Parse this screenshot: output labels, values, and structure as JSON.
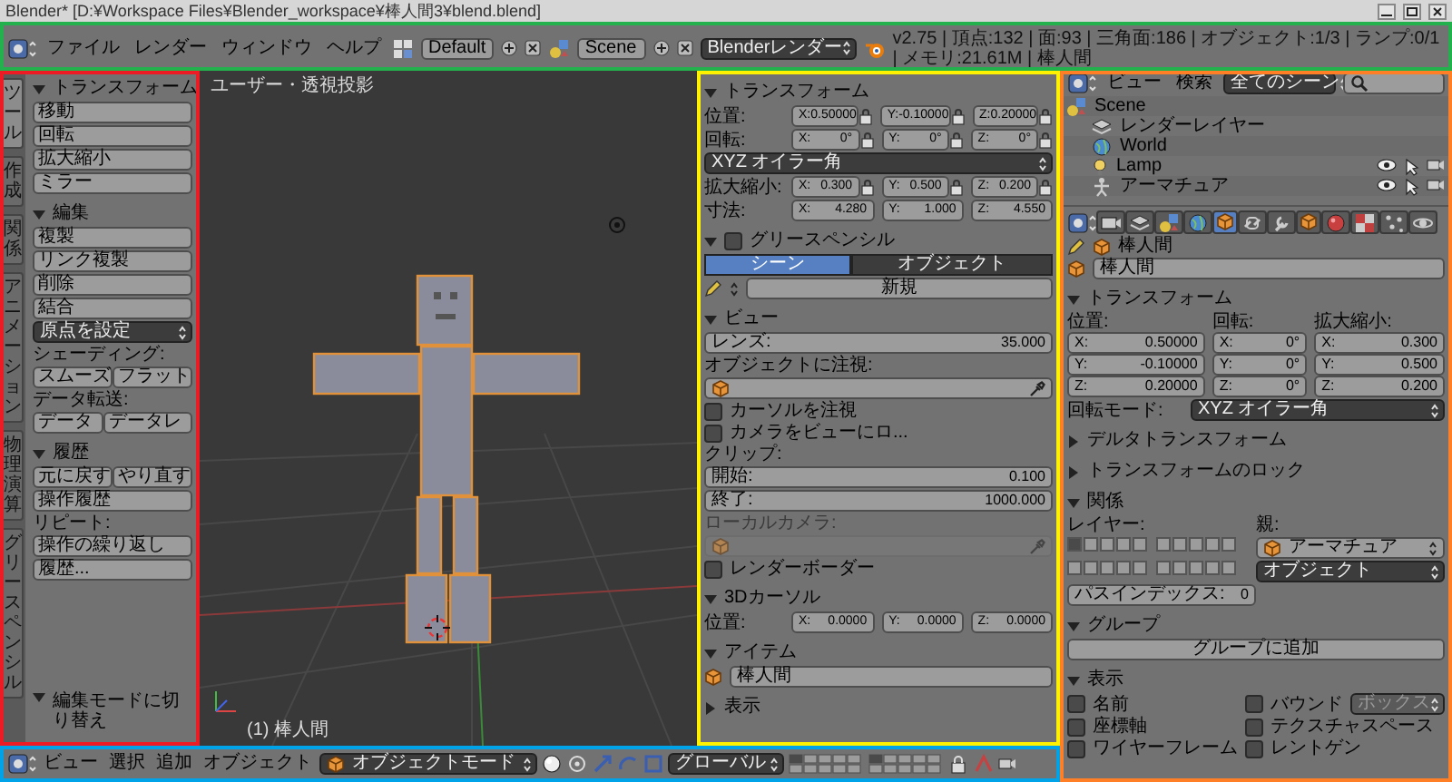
{
  "window": {
    "title": "Blender* [D:¥Workspace Files¥Blender_workspace¥棒人間3¥blend.blend]"
  },
  "highlights": [
    {
      "color": "#22b14c"
    },
    {
      "color": "#ed1c24"
    },
    {
      "color": "#fff200"
    },
    {
      "color": "#ff7f27"
    },
    {
      "color": "#00a2e8"
    }
  ],
  "header": {
    "menus": [
      "ファイル",
      "レンダー",
      "ウィンドウ",
      "ヘルプ"
    ],
    "layout": "Default",
    "scene": "Scene",
    "engine": "Blenderレンダー",
    "stats": "v2.75 | 頂点:132 | 面:93 | 三角面:186 | オブジェクト:1/3 | ランプ:0/1 | メモリ:21.61M | 棒人間"
  },
  "tool_shelf": {
    "tabs": [
      {
        "label": "ツール",
        "selected": true
      },
      {
        "label": "作成",
        "selected": false
      },
      {
        "label": "関係",
        "selected": false
      },
      {
        "label": "アニメーション",
        "selected": false
      },
      {
        "label": "物理演算",
        "selected": false
      },
      {
        "label": "グリースペンシル",
        "selected": false
      }
    ],
    "panels": [
      {
        "title": "トランスフォーム",
        "expanded": true,
        "items": [
          {
            "kind": "buttons",
            "labels": [
              "移動"
            ]
          },
          {
            "kind": "buttons",
            "labels": [
              "回転"
            ]
          },
          {
            "kind": "buttons",
            "labels": [
              "拡大縮小"
            ]
          },
          {
            "kind": "buttons",
            "labels": [
              "ミラー"
            ]
          }
        ]
      },
      {
        "title": "編集",
        "expanded": true,
        "items": [
          {
            "kind": "buttons",
            "labels": [
              "複製"
            ]
          },
          {
            "kind": "buttons",
            "labels": [
              "リンク複製"
            ]
          },
          {
            "kind": "buttons",
            "labels": [
              "削除"
            ]
          },
          {
            "kind": "buttons",
            "labels": [
              "結合"
            ]
          },
          {
            "kind": "dropdown",
            "text": "原点を設定"
          },
          {
            "kind": "label",
            "text": "シェーディング:"
          },
          {
            "kind": "buttons",
            "labels": [
              "スムーズ",
              "フラット"
            ]
          },
          {
            "kind": "label",
            "text": "データ転送:"
          },
          {
            "kind": "buttons",
            "labels": [
              "データ",
              "データレ"
            ]
          }
        ]
      },
      {
        "title": "履歴",
        "expanded": true,
        "items": [
          {
            "kind": "buttons",
            "labels": [
              "元に戻す",
              "やり直す"
            ]
          },
          {
            "kind": "buttons",
            "labels": [
              "操作履歴"
            ]
          },
          {
            "kind": "label",
            "text": "リピート:"
          },
          {
            "kind": "buttons",
            "labels": [
              "操作の繰り返し"
            ]
          },
          {
            "kind": "buttons",
            "labels": [
              "履歴..."
            ]
          }
        ]
      }
    ],
    "operator_panel": {
      "title": "編集モードに切り替え",
      "expanded": true
    }
  },
  "viewport": {
    "view_label": "ユーザー・透視投影",
    "object_label": "(1) 棒人間"
  },
  "n_panel": {
    "panels": [
      {
        "title": "トランスフォーム",
        "expanded": true,
        "items": [
          {
            "kind": "vector",
            "label": "位置:",
            "lockable": true,
            "fields": [
              {
                "axis": "X:",
                "value": "0.50000"
              },
              {
                "axis": "Y:",
                "value": "-0.10000"
              },
              {
                "axis": "Z:",
                "value": "0.20000"
              }
            ]
          },
          {
            "kind": "vector",
            "label": "回転:",
            "lockable": true,
            "fields": [
              {
                "axis": "X:",
                "value": "0°"
              },
              {
                "axis": "Y:",
                "value": "0°"
              },
              {
                "axis": "Z:",
                "value": "0°"
              }
            ]
          },
          {
            "kind": "dropdown",
            "text": "XYZ オイラー角"
          },
          {
            "kind": "vector",
            "label": "拡大縮小:",
            "lockable": true,
            "fields": [
              {
                "axis": "X:",
                "value": "0.300"
              },
              {
                "axis": "Y:",
                "value": "0.500"
              },
              {
                "axis": "Z:",
                "value": "0.200"
              }
            ]
          },
          {
            "kind": "vector",
            "label": "寸法:",
            "lockable": false,
            "fields": [
              {
                "axis": "X:",
                "value": "4.280"
              },
              {
                "axis": "Y:",
                "value": "1.000"
              },
              {
                "axis": "Z:",
                "value": "4.550"
              }
            ]
          }
        ]
      },
      {
        "title": "グリースペンシル",
        "expanded": true,
        "checkbox": false,
        "items": [
          {
            "kind": "toggle",
            "options": [
              {
                "label": "シーン",
                "selected": true
              },
              {
                "label": "オブジェクト",
                "selected": false
              }
            ]
          },
          {
            "kind": "new",
            "text": "新規"
          }
        ]
      },
      {
        "title": "ビュー",
        "expanded": true,
        "items": [
          {
            "kind": "number",
            "label": "レンズ:",
            "value": "35.000"
          },
          {
            "kind": "label",
            "text": "オブジェクトに注視:",
            "disabled": false
          },
          {
            "kind": "object",
            "disabled": false
          },
          {
            "kind": "check",
            "text": "カーソルを注視",
            "checked": false
          },
          {
            "kind": "check",
            "text": "カメラをビューにロ...",
            "checked": false
          },
          {
            "kind": "label",
            "text": "クリップ:",
            "disabled": false
          },
          {
            "kind": "number",
            "label": "開始:",
            "value": "0.100"
          },
          {
            "kind": "number",
            "label": "終了:",
            "value": "1000.000"
          },
          {
            "kind": "label",
            "text": "ローカルカメラ:",
            "disabled": true
          },
          {
            "kind": "object",
            "disabled": true
          },
          {
            "kind": "check",
            "text": "レンダーボーダー",
            "checked": false
          }
        ]
      },
      {
        "title": "3Dカーソル",
        "expanded": true,
        "items": [
          {
            "kind": "vector",
            "label": "位置:",
            "lockable": false,
            "fields": [
              {
                "axis": "X:",
                "value": "0.0000"
              },
              {
                "axis": "Y:",
                "value": "0.0000"
              },
              {
                "axis": "Z:",
                "value": "0.0000"
              }
            ]
          }
        ]
      },
      {
        "title": "アイテム",
        "expanded": true,
        "items": [
          {
            "kind": "object_name",
            "value": "棒人間"
          }
        ]
      },
      {
        "title": "表示",
        "expanded": false
      }
    ]
  },
  "outliner": {
    "menus": [
      "ビュー",
      "検索"
    ],
    "filter": "全てのシーン",
    "tree": [
      {
        "label": "Scene",
        "kind": "scene",
        "children": [
          {
            "label": "レンダーレイヤー",
            "kind": "render_layers"
          },
          {
            "label": "World",
            "kind": "world"
          },
          {
            "label": "Lamp",
            "kind": "lamp"
          },
          {
            "label": "アーマチュア",
            "kind": "armature"
          }
        ]
      }
    ]
  },
  "properties": {
    "tabs": [
      {
        "kind": "render",
        "selected": false
      },
      {
        "kind": "layers",
        "selected": false
      },
      {
        "kind": "scene",
        "selected": false
      },
      {
        "kind": "world",
        "selected": false
      },
      {
        "kind": "object",
        "selected": true
      },
      {
        "kind": "constraints",
        "selected": false
      },
      {
        "kind": "modifiers",
        "selected": false
      },
      {
        "kind": "data",
        "selected": false
      },
      {
        "kind": "material",
        "selected": false
      },
      {
        "kind": "texture",
        "selected": false
      },
      {
        "kind": "particles",
        "selected": false
      },
      {
        "kind": "physics",
        "selected": false
      }
    ],
    "breadcrumb": "棒人間",
    "object_name": "棒人間",
    "panels": [
      {
        "kind": "transform",
        "title": "トランスフォーム",
        "expanded": true,
        "columns": [
          {
            "label": "位置:",
            "fields": [
              {
                "axis": "X:",
                "value": "0.50000"
              },
              {
                "axis": "Y:",
                "value": "-0.10000"
              },
              {
                "axis": "Z:",
                "value": "0.20000"
              }
            ]
          },
          {
            "label": "回転:",
            "fields": [
              {
                "axis": "X:",
                "value": "0°"
              },
              {
                "axis": "Y:",
                "value": "0°"
              },
              {
                "axis": "Z:",
                "value": "0°"
              }
            ]
          },
          {
            "label": "拡大縮小:",
            "fields": [
              {
                "axis": "X:",
                "value": "0.300"
              },
              {
                "axis": "Y:",
                "value": "0.500"
              },
              {
                "axis": "Z:",
                "value": "0.200"
              }
            ]
          }
        ],
        "rotation_mode_label": "回転モード:",
        "rotation_mode": "XYZ オイラー角"
      },
      {
        "kind": "plain",
        "title": "デルタトランスフォーム",
        "expanded": false
      },
      {
        "kind": "plain",
        "title": "トランスフォームのロック",
        "expanded": false
      },
      {
        "kind": "relations",
        "title": "関係",
        "expanded": true,
        "layers_label": "レイヤー:",
        "parent_label": "親:",
        "layers": [
          true,
          false,
          false,
          false,
          false,
          false,
          false,
          false,
          false,
          false,
          false,
          false,
          false,
          false,
          false,
          false,
          false,
          false,
          false,
          false
        ],
        "parent": "アーマチュア",
        "parent_type": "オブジェクト",
        "pass_index_label": "パスインデックス:",
        "pass_index": "0"
      },
      {
        "kind": "groups",
        "title": "グループ",
        "expanded": true,
        "button": "グループに追加"
      },
      {
        "kind": "display",
        "title": "表示",
        "expanded": true,
        "checks": [
          {
            "text": "名前",
            "checked": false
          },
          {
            "text": "バウンド",
            "checked": false
          },
          {
            "text": "座標軸",
            "checked": false
          },
          {
            "text": "テクスチャスペース",
            "checked": false
          },
          {
            "text": "ワイヤーフレーム",
            "checked": false
          },
          {
            "text": "レントゲン",
            "checked": false
          }
        ],
        "bounds_type": "ボックス"
      }
    ]
  },
  "bottom_header": {
    "menus": [
      "ビュー",
      "選択",
      "追加",
      "オブジェクト"
    ],
    "mode": "オブジェクトモード",
    "orientation": "グローバル"
  }
}
